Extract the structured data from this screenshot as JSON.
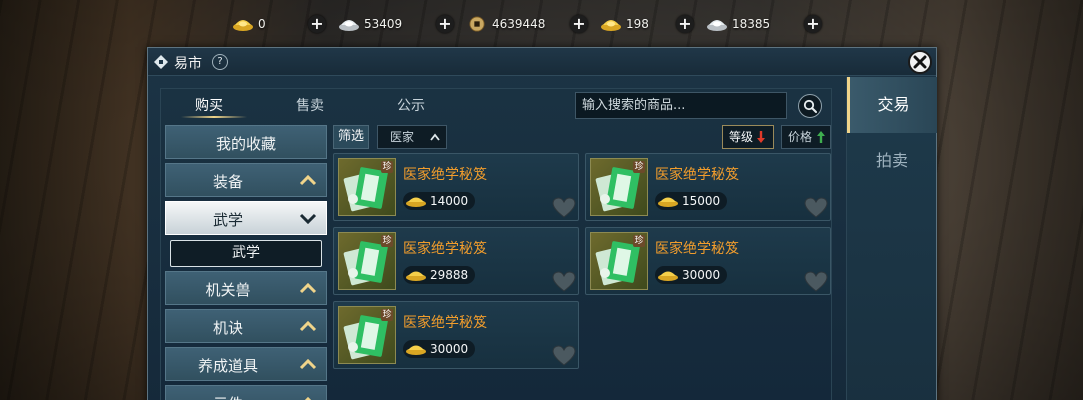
{
  "currency": [
    {
      "icon": "gold-ingot-icon",
      "value": "0"
    },
    {
      "icon": "silver-ingot-icon",
      "value": "53409"
    },
    {
      "icon": "copper-coin-icon",
      "value": "4639448"
    },
    {
      "icon": "bound-gold-ingot-icon",
      "value": "198"
    },
    {
      "icon": "bound-silver-ingot-icon",
      "value": "18385"
    }
  ],
  "window": {
    "title": "易市",
    "help": "?"
  },
  "side_tabs": [
    "交易",
    "拍卖"
  ],
  "top_tabs": [
    "购买",
    "售卖",
    "公示"
  ],
  "search": {
    "placeholder": "输入搜索的商品..."
  },
  "categories": [
    "我的收藏",
    "装备",
    "武学",
    "机关兽",
    "机诀",
    "养成道具",
    "元件"
  ],
  "subcategory": "武学",
  "filter": {
    "label": "筛选",
    "selected": "医家"
  },
  "sort": {
    "level": "等级",
    "price": "价格"
  },
  "items": [
    {
      "name": "医家绝学秘笈",
      "price": "14000",
      "badge": "珍"
    },
    {
      "name": "医家绝学秘笈",
      "price": "15000",
      "badge": "珍"
    },
    {
      "name": "医家绝学秘笈",
      "price": "29888",
      "badge": "珍"
    },
    {
      "name": "医家绝学秘笈",
      "price": "30000",
      "badge": "珍"
    },
    {
      "name": "医家绝学秘笈",
      "price": "30000",
      "badge": "珍"
    }
  ],
  "colors": {
    "accent_gold": "#f0d48a",
    "item_name_orange": "#f29d2c",
    "panel_blue": "#1a3242"
  }
}
